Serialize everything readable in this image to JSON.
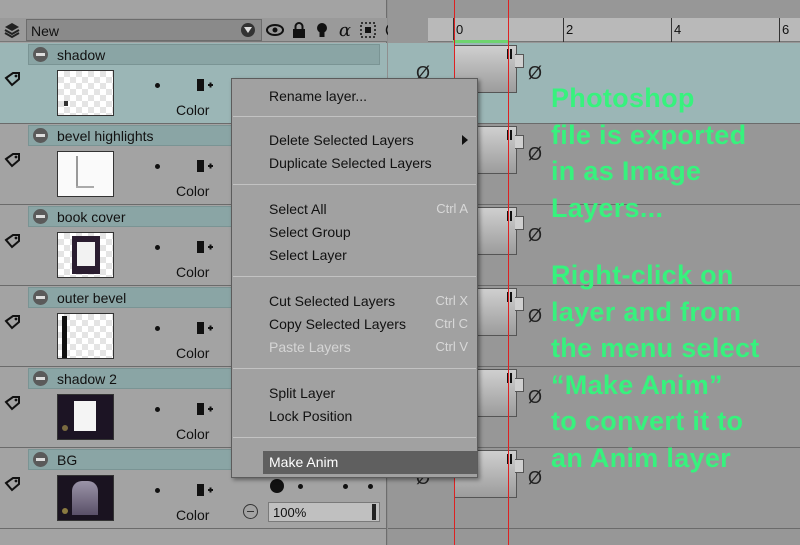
{
  "header": {
    "new_label": "New"
  },
  "layers": [
    {
      "name": "shadow",
      "mode": "Color",
      "selected": true
    },
    {
      "name": "bevel highlights",
      "mode": "Color",
      "selected": false
    },
    {
      "name": "book cover",
      "mode": "Color",
      "selected": false
    },
    {
      "name": "outer bevel",
      "mode": "Color",
      "selected": false
    },
    {
      "name": "shadow 2",
      "mode": "Color",
      "selected": false
    },
    {
      "name": "BG",
      "mode": "Color",
      "selected": false,
      "opacity": "100%"
    }
  ],
  "timeline": {
    "ruler_labels": [
      "0",
      "2",
      "4",
      "6"
    ],
    "empty_glyph": "Ø"
  },
  "context_menu": {
    "rename": "Rename layer...",
    "delete": "Delete Selected Layers",
    "duplicate": "Duplicate Selected Layers",
    "select_all": "Select All",
    "select_all_sc": "Ctrl A",
    "select_group": "Select Group",
    "select_layer": "Select Layer",
    "cut": "Cut Selected Layers",
    "cut_sc": "Ctrl X",
    "copy": "Copy Selected Layers",
    "copy_sc": "Ctrl C",
    "paste": "Paste Layers",
    "paste_sc": "Ctrl V",
    "split": "Split Layer",
    "lock": "Lock Position",
    "make_anim": "Make Anim"
  },
  "annotation": {
    "para1": [
      "Photoshop",
      "file is exported",
      "in as Image",
      "Layers..."
    ],
    "para2": [
      "Right-click on",
      "layer and from",
      "the menu select",
      "“Make Anim”",
      "to convert it to",
      "an Anim layer"
    ],
    "color": "#37f27d"
  }
}
